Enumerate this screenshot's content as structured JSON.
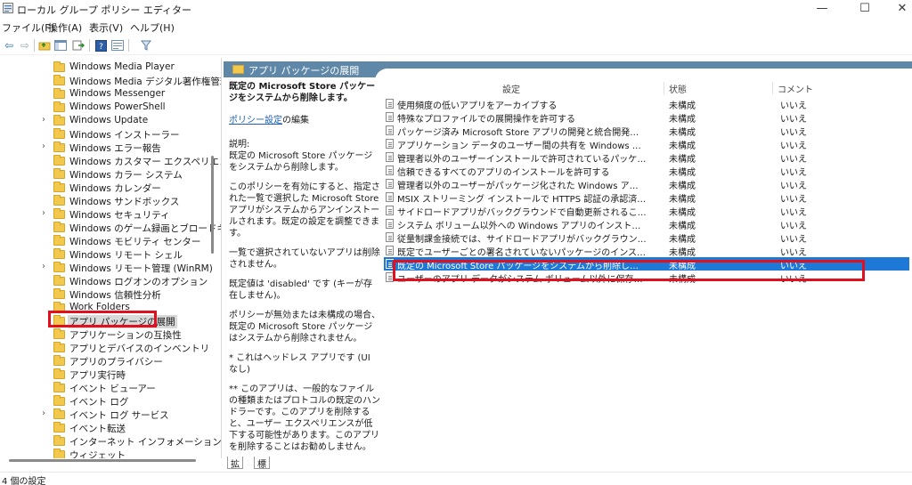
{
  "window": {
    "title": "ローカル グループ ポリシー エディター",
    "minimize": "—",
    "maximize": "☐",
    "close": "✕"
  },
  "menu": [
    "ファイル(F)",
    "操作(A)",
    "表示(V)",
    "ヘルプ(H)"
  ],
  "tree": [
    {
      "label": "Windows Media Player",
      "chevron": ""
    },
    {
      "label": "Windows Media デジタル著作権管理",
      "chevron": ""
    },
    {
      "label": "Windows Messenger",
      "chevron": ""
    },
    {
      "label": "Windows PowerShell",
      "chevron": ""
    },
    {
      "label": "Windows Update",
      "chevron": "›"
    },
    {
      "label": "Windows インストーラー",
      "chevron": ""
    },
    {
      "label": "Windows エラー報告",
      "chevron": "›"
    },
    {
      "label": "Windows カスタマー エクスペリエンス向",
      "chevron": ""
    },
    {
      "label": "Windows カラー システム",
      "chevron": ""
    },
    {
      "label": "Windows カレンダー",
      "chevron": ""
    },
    {
      "label": "Windows サンドボックス",
      "chevron": ""
    },
    {
      "label": "Windows セキュリティ",
      "chevron": "›"
    },
    {
      "label": "Windows のゲーム録画とブロードキャスト",
      "chevron": ""
    },
    {
      "label": "Windows モビリティ センター",
      "chevron": ""
    },
    {
      "label": "Windows リモート シェル",
      "chevron": ""
    },
    {
      "label": "Windows リモート管理 (WinRM)",
      "chevron": "›"
    },
    {
      "label": "Windows ログオンのオプション",
      "chevron": ""
    },
    {
      "label": "Windows 信頼性分析",
      "chevron": ""
    },
    {
      "label": "Work Folders",
      "chevron": ""
    },
    {
      "label": "アプリ パッケージの展開",
      "chevron": "",
      "selected": true
    },
    {
      "label": "アプリケーションの互換性",
      "chevron": ""
    },
    {
      "label": "アプリとデバイスのインベントリ",
      "chevron": ""
    },
    {
      "label": "アプリのプライバシー",
      "chevron": ""
    },
    {
      "label": "アプリ実行時",
      "chevron": ""
    },
    {
      "label": "イベント ビューアー",
      "chevron": ""
    },
    {
      "label": "イベント ログ",
      "chevron": ""
    },
    {
      "label": "イベント ログ サービス",
      "chevron": "›"
    },
    {
      "label": "イベント転送",
      "chevron": ""
    },
    {
      "label": "インターネット インフォメーション サービス",
      "chevron": ""
    },
    {
      "label": "ウィジェット",
      "chevron": ""
    }
  ],
  "right": {
    "header_title": "アプリ パッケージの展開",
    "desc_title": "既定の Microsoft Store パッケージをシステムから削除します。",
    "desc_link": "ポリシー設定",
    "desc_link_suffix": "の編集",
    "desc_label": "説明:",
    "desc_body1": "既定の Microsoft Store パッケージをシステムから削除します。",
    "desc_body2": "このポリシーを有効にすると、指定された一覧で選択した Microsoft Store アプリがシステムからアンインストールされます。既定の設定を調整できます。",
    "desc_body3": "一覧で選択されていないアプリは削除されません。",
    "desc_body4": "既定値は 'disabled' です (キーが存在しません)。",
    "desc_body5": "ポリシーが無効または未構成の場合、既定の Microsoft Store パッケージはシステムから削除されません。",
    "desc_body6": "* これはヘッドレス アプリです (UI なし)",
    "desc_body7": "** このアプリは、一般的なファイルの種類またはプロトコルの既定のハンドラーです。このアプリを削除すると、ユーザー エクスペリエンスが低下する可能性があります。このアプリを削除することはお勧めしません。",
    "col_setting": "設定",
    "col_state": "状態",
    "col_comment": "コメント"
  },
  "policies": [
    {
      "name": "使用頻度の低いアプリをアーカイブする",
      "state": "未構成",
      "comment": "いいえ"
    },
    {
      "name": "特殊なプロファイルでの展開操作を許可する",
      "state": "未構成",
      "comment": "いいえ"
    },
    {
      "name": "パッケージ済み Microsoft Store アプリの開発と統合開発環境 (ID...",
      "state": "未構成",
      "comment": "いいえ"
    },
    {
      "name": "アプリケーション データのユーザー間の共有を Windows アプリに許可...",
      "state": "未構成",
      "comment": "いいえ"
    },
    {
      "name": "管理者以外のユーザーインストールで許可されているパッケージ ファミ...",
      "state": "未構成",
      "comment": "いいえ"
    },
    {
      "name": "信頼できるすべてのアプリのインストールを許可する",
      "state": "未構成",
      "comment": "いいえ"
    },
    {
      "name": "管理者以外のユーザーがパッケージ化された Windows アプリをイン...",
      "state": "未構成",
      "comment": "いいえ"
    },
    {
      "name": "MSIX ストリーミング インストールで HTTPS 認証の承認済みドメインを...",
      "state": "未構成",
      "comment": "いいえ"
    },
    {
      "name": "サイドロードアプリがバックグラウンドで自動更新されることを許可しない",
      "state": "未構成",
      "comment": "いいえ"
    },
    {
      "name": "システム ボリューム以外への Windows アプリのインストールを無効に...",
      "state": "未構成",
      "comment": "いいえ"
    },
    {
      "name": "従量制課金接続では、サイドロードアプリがバックグラウンドで自動更...",
      "state": "未構成",
      "comment": "いいえ"
    },
    {
      "name": "既定でユーザーごとの署名されていないパッケージのインストールを許...",
      "state": "未構成",
      "comment": "いいえ"
    },
    {
      "name": "既定の Microsoft Store パッケージをシステムから削除します。",
      "state": "未構成",
      "comment": "いいえ",
      "selected": true
    },
    {
      "name": "ユーザーのアプリ データがシステム ボリューム以外に保存されないように...",
      "state": "未構成",
      "comment": "いいえ"
    }
  ],
  "tabs": [
    "拡張",
    "標準"
  ],
  "status": "4 個の設定"
}
